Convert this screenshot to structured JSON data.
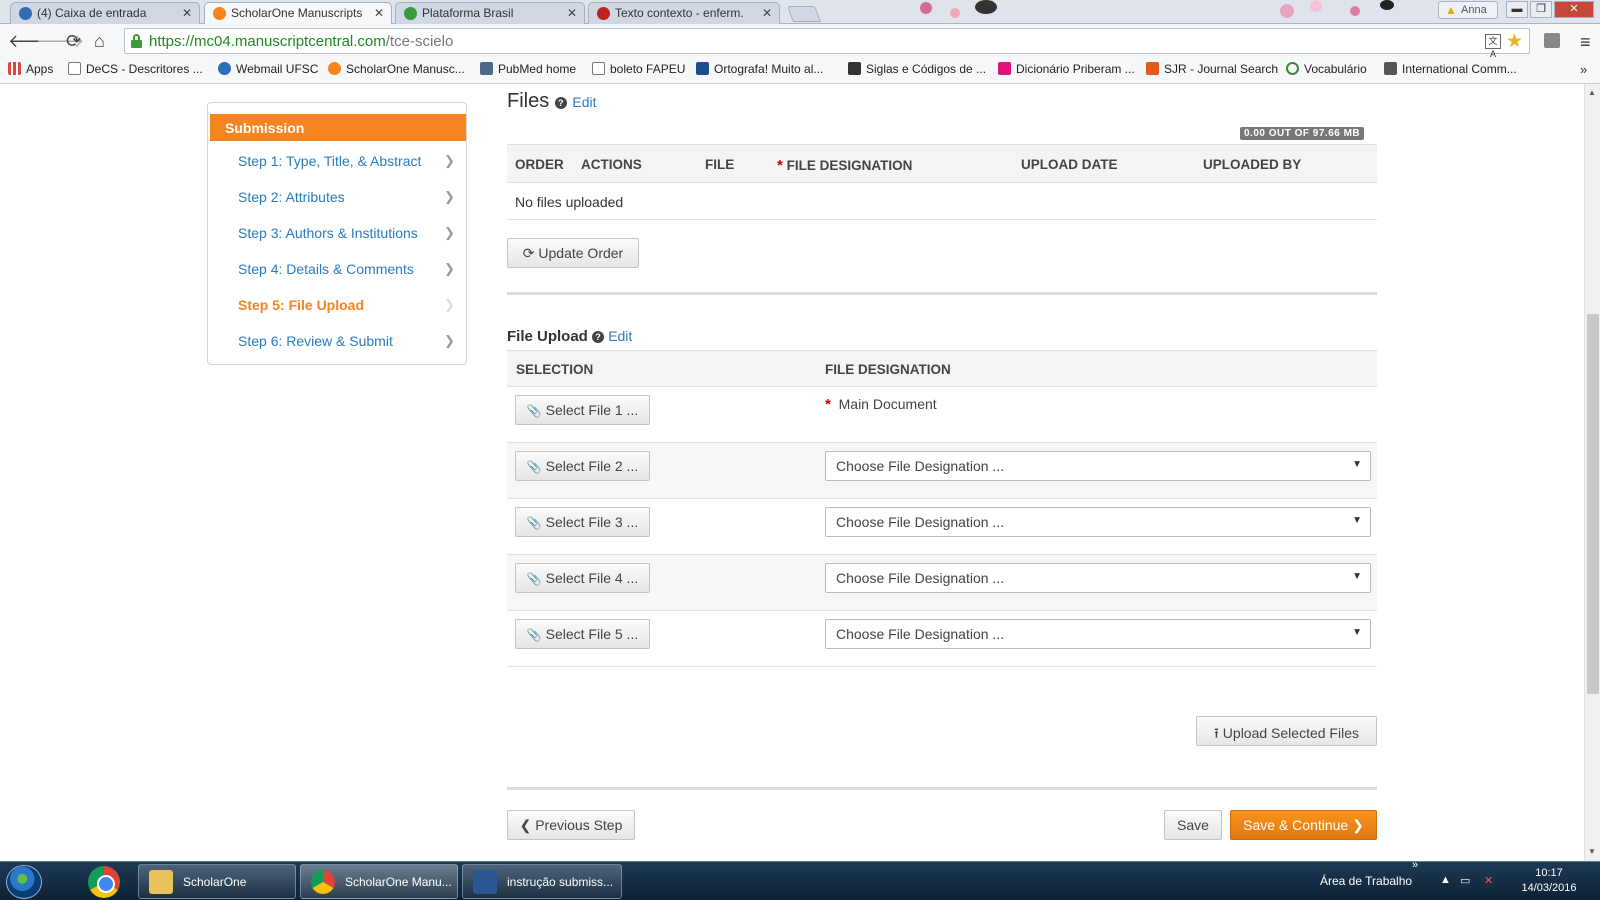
{
  "browser": {
    "tabs": [
      {
        "title": "(4) Caixa de entrada",
        "active": false,
        "color": "#2f6db5"
      },
      {
        "title": "ScholarOne Manuscripts",
        "active": true,
        "color": "#f6841f"
      },
      {
        "title": "Plataforma Brasil",
        "active": false,
        "color": "#3c9a3c"
      },
      {
        "title": "Texto contexto - enferm.",
        "active": false,
        "color": "#b22"
      }
    ],
    "user_name": "Anna",
    "url_host": "https://mc04.manuscriptcentral.com",
    "url_path": "/tce-scielo",
    "bookmarks": [
      {
        "label": "Apps",
        "color": "#d44"
      },
      {
        "label": "DeCS - Descritores ...",
        "color": "#fff"
      },
      {
        "label": "Webmail UFSC",
        "color": "#2a6fb5"
      },
      {
        "label": "ScholarOne Manusc...",
        "color": "#f6841f"
      },
      {
        "label": "PubMed home",
        "color": "#4a6a8a"
      },
      {
        "label": "boleto FAPEU",
        "color": "#fff"
      },
      {
        "label": "Ortografa! Muito al...",
        "color": "#1e4e8c"
      },
      {
        "label": "Siglas e Códigos de ...",
        "color": "#333"
      },
      {
        "label": "Dicionário Priberam ...",
        "color": "#e0127c"
      },
      {
        "label": "SJR - Journal Search",
        "color": "#e35b1c"
      },
      {
        "label": "Vocabulário",
        "color": "#3a8a3a"
      },
      {
        "label": "International Comm...",
        "color": "#555"
      }
    ]
  },
  "sidebar": {
    "heading": "Submission",
    "steps": [
      {
        "label": "Step 1: Type, Title, & Abstract",
        "active": false
      },
      {
        "label": "Step 2: Attributes",
        "active": false
      },
      {
        "label": "Step 3: Authors & Institutions",
        "active": false
      },
      {
        "label": "Step 4: Details & Comments",
        "active": false
      },
      {
        "label": "Step 5: File Upload",
        "active": true
      },
      {
        "label": "Step 6: Review & Submit",
        "active": false
      }
    ]
  },
  "files": {
    "title": "Files",
    "edit_label": "Edit",
    "quota": "0.00 OUT OF 97.66 MB",
    "columns": [
      "ORDER",
      "ACTIONS",
      "FILE",
      "FILE DESIGNATION",
      "UPLOAD DATE",
      "UPLOADED BY"
    ],
    "empty_text": "No files uploaded",
    "update_order_label": "Update Order"
  },
  "file_upload": {
    "title": "File Upload",
    "edit_label": "Edit",
    "columns": [
      "SELECTION",
      "FILE DESIGNATION"
    ],
    "rows": [
      {
        "button": "Select File 1 ...",
        "designation": "Main Document",
        "required": true
      },
      {
        "button": "Select File 2 ...",
        "designation": "Choose File Designation ...",
        "required": false
      },
      {
        "button": "Select File 3 ...",
        "designation": "Choose File Designation ...",
        "required": false
      },
      {
        "button": "Select File 4 ...",
        "designation": "Choose File Designation ...",
        "required": false
      },
      {
        "button": "Select File 5 ...",
        "designation": "Choose File Designation ...",
        "required": false
      }
    ],
    "upload_label": "Upload Selected Files"
  },
  "footer": {
    "previous_label": "Previous Step",
    "save_label": "Save",
    "save_continue_label": "Save & Continue"
  },
  "taskbar": {
    "items": [
      {
        "label": "ScholarOne"
      },
      {
        "label": "ScholarOne Manu..."
      },
      {
        "label": "instrução submiss..."
      }
    ],
    "desktop_label": "Área de Trabalho",
    "time": "10:17",
    "date": "14/03/2016"
  }
}
